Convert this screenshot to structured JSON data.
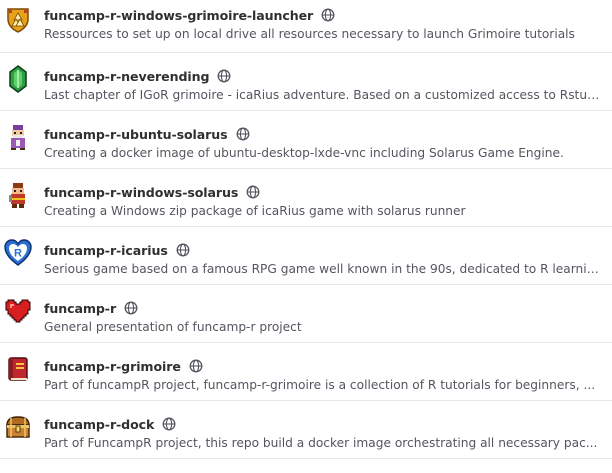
{
  "projects": [
    {
      "name": "funcamp-r-windows-grimoire-launcher",
      "description": "Ressources to set up on local drive all resources necessary to launch Grimoire tutorials",
      "avatar_icon": "triforce-shield-icon",
      "visibility_icon": "public-globe-icon"
    },
    {
      "name": "funcamp-r-neverending",
      "description": "Last chapter of IGoR grimoire - icaRius adventure. Based on a customized access to Rstudio...",
      "avatar_icon": "green-rupee-icon",
      "visibility_icon": "public-globe-icon"
    },
    {
      "name": "funcamp-r-ubuntu-solarus",
      "description": "Creating a docker image of ubuntu-desktop-lxde-vnc including Solarus Game Engine.",
      "avatar_icon": "old-sage-sprite-icon",
      "visibility_icon": "public-globe-icon"
    },
    {
      "name": "funcamp-r-windows-solarus",
      "description": "Creating a Windows zip package of icaRius game with solarus runner",
      "avatar_icon": "warrior-sprite-icon",
      "visibility_icon": "public-globe-icon"
    },
    {
      "name": "funcamp-r-icarius",
      "description": "Serious game based on a famous RPG game well known in the 90s, dedicated to R learning...",
      "avatar_icon": "r-heart-shield-icon",
      "avatar_letter": "R",
      "visibility_icon": "public-globe-icon"
    },
    {
      "name": "funcamp-r",
      "description": "General presentation of funcamp-r project",
      "avatar_icon": "pixel-heart-icon",
      "visibility_icon": "public-globe-icon"
    },
    {
      "name": "funcamp-r-grimoire",
      "description": "Part of funcampR project, funcamp-r-grimoire is a collection of R tutorials for beginners, ...",
      "avatar_icon": "red-book-icon",
      "visibility_icon": "public-globe-icon"
    },
    {
      "name": "funcamp-r-dock",
      "description": "Part of FuncampR project, this repo build a docker image orchestrating all necessary pac...",
      "avatar_icon": "treasure-chest-icon",
      "visibility_icon": "public-globe-icon"
    }
  ],
  "colors": {
    "title": "#303030",
    "description": "#555560",
    "divider": "#e8e8ee",
    "globe": "#555560"
  }
}
